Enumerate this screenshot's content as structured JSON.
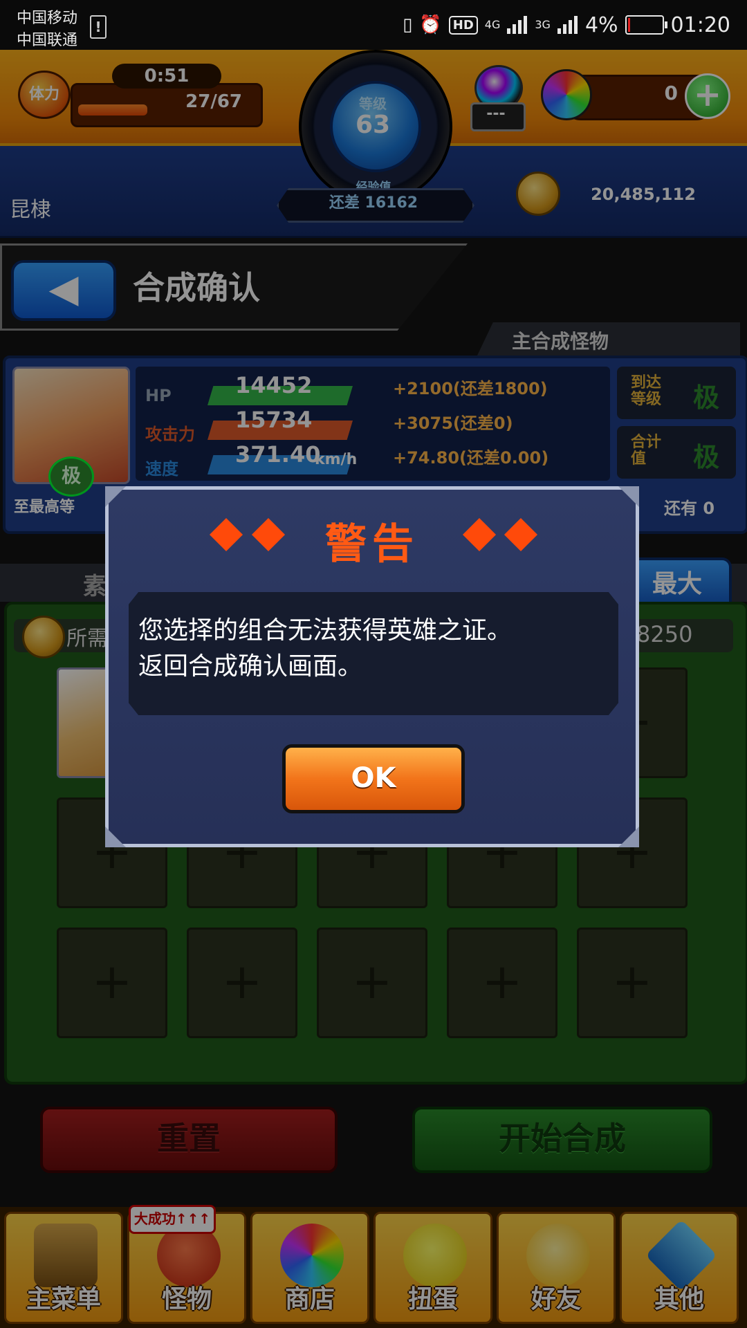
{
  "status_bar": {
    "carrier1": "中国移动",
    "carrier2": "中国联通",
    "net1": "4G",
    "net2": "3G",
    "battery": "4%",
    "time": "01:20"
  },
  "hud": {
    "stamina_label": "体力",
    "stamina_timer": "0:51",
    "stamina_value": "27/67",
    "stamina_fill": 0.4,
    "level_label": "等级",
    "level_value": "63",
    "exp_label": "经验值",
    "exp_value": "还差 16162",
    "gacha_value": "---",
    "orb_count": "0",
    "orb_add": "+",
    "player_name": "昆棣",
    "coins": "20,485,112"
  },
  "header": {
    "back_icon": "◀",
    "title": "合成确认"
  },
  "monster_panel": {
    "tab_label": "主合成怪物",
    "rank_badge": "极",
    "stats": [
      {
        "label": "HP",
        "value": "14452",
        "bonus": "+2100(还差1800)",
        "color": "#35b84a"
      },
      {
        "label": "攻击力",
        "value": "15734",
        "bonus": "+3075(还差0)",
        "color": "#e05a2a"
      },
      {
        "label": "速度",
        "value": "371.40",
        "bonus": "+74.80(还差0.00)",
        "color": "#2a8ae0"
      }
    ],
    "speed_unit": "km/h",
    "level_card_label": "到达\n等级",
    "level_card_value": "极",
    "hsum_card_label": "合计\n值",
    "hsum_card_value": "极",
    "bottom_left": "至最高等",
    "bottom_right": "还有 0"
  },
  "materials": {
    "tab_label": "素",
    "max_button": "最大",
    "cost_label": "所需",
    "cost_value": "8250",
    "slot_placeholder": "+"
  },
  "actions": {
    "reset_label": "重置",
    "synth_label": "开始合成"
  },
  "nav": {
    "items": [
      {
        "label": "主菜单"
      },
      {
        "label": "怪物"
      },
      {
        "label": "商店"
      },
      {
        "label": "扭蛋"
      },
      {
        "label": "好友"
      },
      {
        "label": "其他"
      }
    ],
    "badge": "大成功↑↑↑"
  },
  "modal": {
    "title": "警告",
    "message_line1": "您选择的组合无法获得英雄之证。",
    "message_line2": "返回合成确认画面。",
    "ok_label": "OK"
  },
  "colors": {
    "warning_title": "#ff5a14",
    "ok_button": "#f2741a",
    "hud_orange": "#f28a0a"
  }
}
